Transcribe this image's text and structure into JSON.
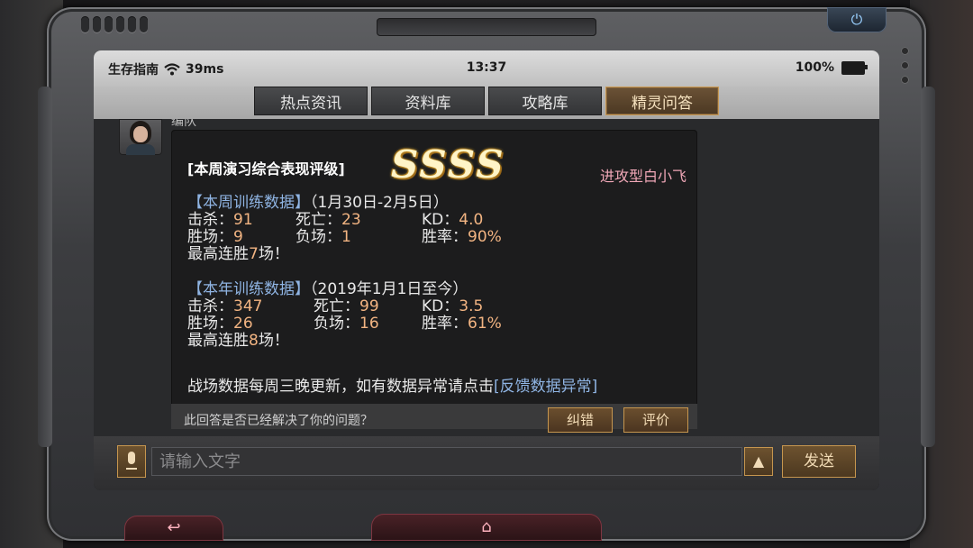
{
  "status": {
    "carrier": "生存指南",
    "latency": "39ms",
    "time": "13:37",
    "battery": "100%"
  },
  "tabs": [
    {
      "label": "热点资讯",
      "active": false
    },
    {
      "label": "资料库",
      "active": false
    },
    {
      "label": "攻略库",
      "active": false
    },
    {
      "label": "精灵问答",
      "active": true
    }
  ],
  "message": {
    "user_name": "编队",
    "title": "[本周演习综合表现评级]",
    "grade": "SSSS",
    "author": "进攻型白小飞",
    "week": {
      "header": "【本周训练数据】",
      "range": "（1月30日-2月5日）",
      "kills_label": "击杀：",
      "kills": "91",
      "deaths_label": "死亡：",
      "deaths": "23",
      "kd_label": "KD：",
      "kd": "4.0",
      "wins_label": "胜场：",
      "wins": "9",
      "losses_label": "负场：",
      "losses": "1",
      "winrate_label": "胜率：",
      "winrate": "90%",
      "streak_prefix": "最高连胜",
      "streak": "7",
      "streak_suffix": "场！"
    },
    "year": {
      "header": "【本年训练数据】",
      "range": "（2019年1月1日至今）",
      "kills_label": "击杀：",
      "kills": "347",
      "deaths_label": "死亡：",
      "deaths": "99",
      "kd_label": "KD：",
      "kd": "3.5",
      "wins_label": "胜场：",
      "wins": "26",
      "losses_label": "负场：",
      "losses": "16",
      "winrate_label": "胜率：",
      "winrate": "61%",
      "streak_prefix": "最高连胜",
      "streak": "8",
      "streak_suffix": "场！"
    },
    "update_note": "战场数据每周三晚更新，如有数据异常请点击",
    "feedback_link": "[反馈数据异常]",
    "resolved_question": "此回答是否已经解决了你的问题？",
    "correct_label": "纠错",
    "rate_label": "评价"
  },
  "input": {
    "placeholder": "请输入文字",
    "send_label": "发送",
    "expand_glyph": "▲"
  },
  "nav": {
    "back_glyph": "↩",
    "home_glyph": "⌂",
    "power_glyph": "⏻"
  },
  "colors": {
    "accent_gold": "#c6964f",
    "link_blue": "#8fb4e3",
    "value_orange": "#f2b482",
    "author_pink": "#f0a7b7"
  }
}
